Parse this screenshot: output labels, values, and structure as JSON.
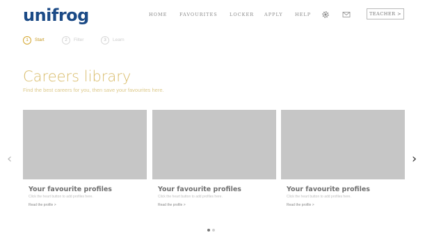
{
  "header": {
    "logo_text": "unifrog",
    "nav": [
      {
        "label": "HOME"
      },
      {
        "label": "FAVOURITES"
      },
      {
        "label": "LOCKER"
      },
      {
        "label": "APPLY"
      },
      {
        "label": "HELP"
      }
    ],
    "icons": [
      "gear-icon",
      "mail-icon"
    ],
    "teacher_button": "TEACHER >"
  },
  "steps": [
    {
      "number": "1",
      "label": "Start",
      "active": true
    },
    {
      "number": "2",
      "label": "Filter",
      "active": false
    },
    {
      "number": "3",
      "label": "Learn",
      "active": false
    }
  ],
  "main": {
    "title": "Careers library",
    "subtitle": "Find the best careers for you, then save your favourites here.",
    "cards": [
      {
        "title": "Your favourite profiles",
        "description": "Click the heart button to add profiles here.",
        "link": "Read the profile >"
      },
      {
        "title": "Your favourite profiles",
        "description": "Click the heart button to add profiles here.",
        "link": "Read the profile >"
      },
      {
        "title": "Your favourite profiles",
        "description": "Click the heart button to add profiles here.",
        "link": "Read the profile >"
      }
    ]
  },
  "colors": {
    "brand": "#1b4a86",
    "accent": "#d4a62c",
    "placeholder": "#c6c6c6"
  },
  "carousel": {
    "pages": 2,
    "current": 1
  }
}
